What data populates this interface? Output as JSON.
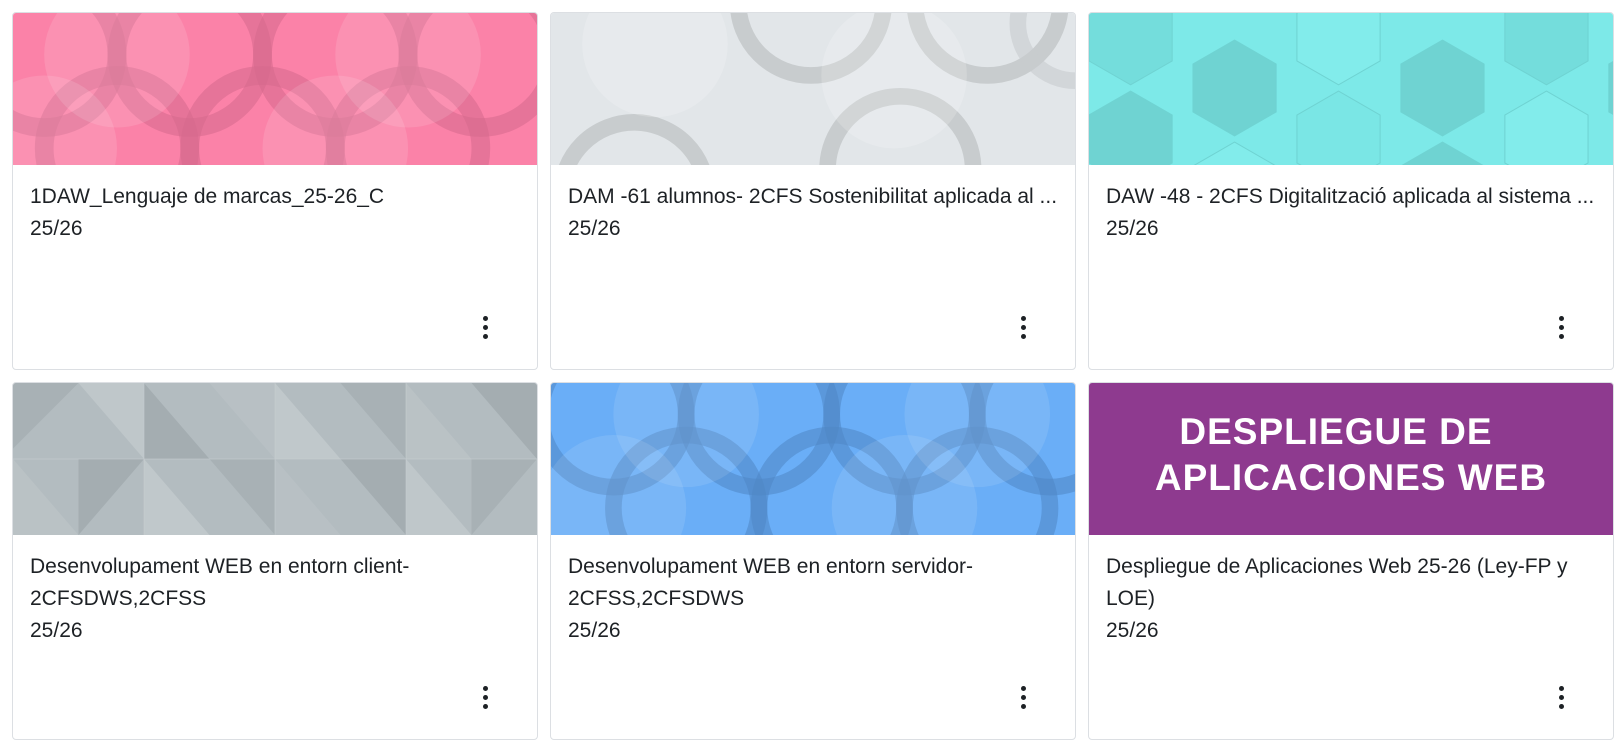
{
  "courses": [
    {
      "title": "1DAW_Lenguaje de marcas_25-26_C",
      "term": "25/26",
      "banner_pattern": "circles-pink",
      "banner_color": "#fb82a8",
      "menu_icon": "kebab-menu-icon"
    },
    {
      "title": "DAM -61 alumnos- 2CFS Sostenibilitat aplicada al ...",
      "term": "25/26",
      "banner_pattern": "circles-light-gray",
      "banner_color": "#e2e6e9",
      "menu_icon": "kebab-menu-icon"
    },
    {
      "title": "DAW -48 - 2CFS Digitalització aplicada al sistema ...",
      "term": "25/26",
      "banner_pattern": "hexagons-cyan",
      "banner_color": "#7de9e8",
      "menu_icon": "kebab-menu-icon"
    },
    {
      "title": "Desenvolupament WEB en entorn client-2CFSDWS,2CFSS",
      "term": "25/26",
      "banner_pattern": "triangles-gray",
      "banner_color": "#b3bcc0",
      "menu_icon": "kebab-menu-icon"
    },
    {
      "title": "Desenvolupament WEB en entorn servidor-2CFSS,2CFSDWS",
      "term": "25/26",
      "banner_pattern": "circles-blue",
      "banner_color": "#6aaef7",
      "menu_icon": "kebab-menu-icon"
    },
    {
      "title": "Despliegue de Aplicaciones Web 25-26 (Ley-FP y LOE)",
      "term": "25/26",
      "banner_pattern": "image-text",
      "banner_color": "#8e3a8f",
      "banner_text_line1": "DESPLIEGUE DE",
      "banner_text_line2": "APLICACIONES WEB",
      "menu_icon": "kebab-menu-icon"
    }
  ]
}
